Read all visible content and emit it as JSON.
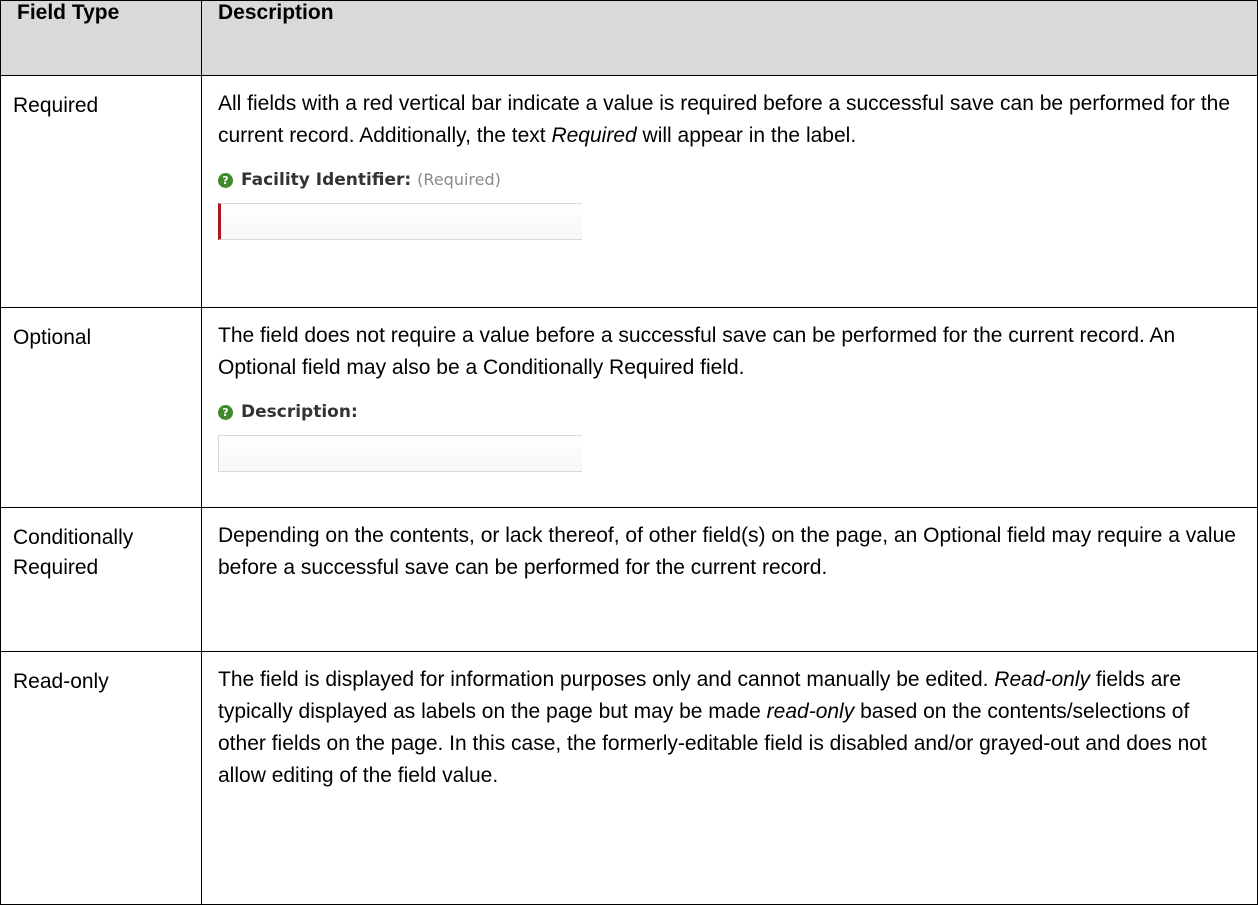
{
  "table": {
    "headers": {
      "field_type": "Field Type",
      "description": "Description"
    },
    "rows": [
      {
        "type": "Required",
        "desc_parts": [
          "All fields with a red vertical bar indicate a value is required before a successful save can be performed for the current record. Additionally, the text ",
          "Required",
          " will appear in the label."
        ],
        "sample": {
          "label": "Facility Identifier:",
          "suffix": "(Required)",
          "bar_color": "#b0141c"
        }
      },
      {
        "type": "Optional",
        "desc_parts": [
          "The field does not require a value before a successful save can be performed for the current record. An Optional field may also be a Conditionally Required field."
        ],
        "sample": {
          "label": "Description:"
        }
      },
      {
        "type": "Conditionally Required",
        "desc_parts": [
          "Depending on the contents, or lack thereof, of other field(s) on the page, an Optional field may require a value before a successful save can be performed for the current record."
        ]
      },
      {
        "type": "Read-only",
        "desc_parts": [
          "The field is displayed for information purposes only and cannot manually be edited. ",
          "Read-only",
          " fields are typically displayed as labels on the page but may be made ",
          "read-only",
          " based on the contents/selections of other fields on the page. In this case, the formerly-editable field is disabled and/or grayed-out and does not allow editing of the field value."
        ]
      }
    ]
  },
  "icons": {
    "help": "help-question-icon",
    "help_color": "#3f8a2a",
    "help_glyph": "?"
  }
}
